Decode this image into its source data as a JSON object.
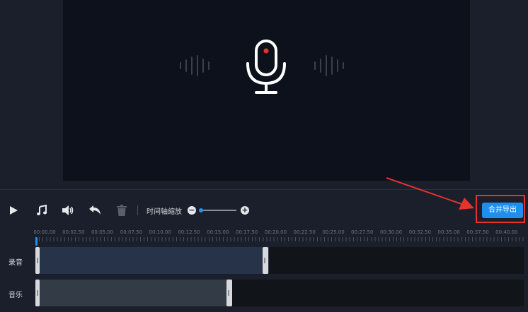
{
  "toolbar": {
    "play_icon": "play-icon",
    "music_icon": "music-note-icon",
    "volume_icon": "volume-icon",
    "undo_icon": "undo-icon",
    "delete_icon": "trash-icon",
    "zoom_label": "时间轴缩放",
    "zoom_minus": "−",
    "zoom_plus": "+",
    "zoom_level": 0.0,
    "export_label": "合并导出"
  },
  "timeline": {
    "ticks": [
      "00:00.00",
      "00:02.50",
      "00:05.00",
      "00:07.50",
      "00:10.00",
      "00:12.50",
      "00:15.00",
      "00:17.50",
      "00:20.00",
      "00:22.50",
      "00:25.00",
      "00:27.50",
      "00:30.00",
      "00:32.50",
      "00:35.00",
      "00:37.50",
      "00:40.00"
    ],
    "tracks": [
      {
        "label": "录音"
      },
      {
        "label": "音乐"
      }
    ]
  },
  "colors": {
    "accent": "#1e8ff0",
    "highlight": "#e5332e",
    "mic_dot": "#e5332e"
  }
}
